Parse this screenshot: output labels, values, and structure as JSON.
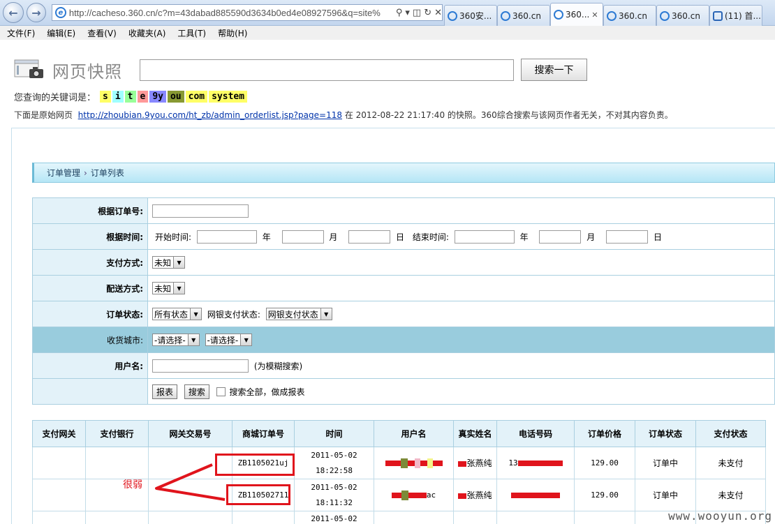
{
  "browser": {
    "address": "http://cacheso.360.cn/c?m=43dabad885590d3634b0ed4e08927596&q=site%",
    "tabs": [
      {
        "label": "360安..."
      },
      {
        "label": "360.cn"
      },
      {
        "label": "360..."
      },
      {
        "label": "360.cn"
      },
      {
        "label": "360.cn"
      },
      {
        "label": "(11) 首..."
      }
    ],
    "menu": [
      "文件(F)",
      "编辑(E)",
      "查看(V)",
      "收藏夹(A)",
      "工具(T)",
      "帮助(H)"
    ]
  },
  "snapshot": {
    "title": "网页快照",
    "search_button": "搜索一下",
    "keyword_label": "您查询的关键词是：",
    "keywords": [
      {
        "text": "s",
        "color": "#ffff66"
      },
      {
        "text": "i",
        "color": "#a0ffff"
      },
      {
        "text": "t",
        "color": "#99ff99"
      },
      {
        "text": "e",
        "color": "#ff9999"
      },
      {
        "text": "9y",
        "color": "#8888ff"
      },
      {
        "text": "ou",
        "color": "#889933"
      },
      {
        "text": "com",
        "color": "#ffff66"
      },
      {
        "text": "system",
        "color": "#ffff66"
      }
    ],
    "orig_prefix": "下面是原始网页",
    "orig_url": "http://zhoubian.9you.com/ht_zb/admin_orderlist.jsp?page=118",
    "orig_suffix": "在 2012-08-22 21:17:40 的快照。360综合搜索与该网页作者无关，不对其内容负责。"
  },
  "page": {
    "breadcrumb": [
      "订单管理",
      "订单列表"
    ],
    "filters": {
      "order_no_label": "根据订单号:",
      "time_label": "根据时间:",
      "start_label": "开始时间:",
      "end_label": "结束时间:",
      "year": "年",
      "month": "月",
      "day": "日",
      "pay_method_label": "支付方式:",
      "pay_method_value": "未知",
      "delivery_label": "配送方式:",
      "delivery_value": "未知",
      "status_label": "订单状态:",
      "status_value": "所有状态",
      "bank_status_label": "网银支付状态:",
      "bank_status_value": "网银支付状态",
      "city_label": "收货城市:",
      "city_value1": "-请选择-",
      "city_value2": "-请选择-",
      "user_label": "用户名:",
      "fuzzy_hint": "(为模糊搜索)",
      "report_button": "报表",
      "search_button": "搜索",
      "search_all_label": "搜索全部，做成报表"
    },
    "table": {
      "headers": [
        "支付网关",
        "支付银行",
        "网关交易号",
        "商城订单号",
        "时间",
        "用户名",
        "真实姓名",
        "电话号码",
        "订单价格",
        "订单状态",
        "支付状态"
      ],
      "rows": [
        {
          "order_no": "ZB1105021uj",
          "date": "2011-05-02",
          "time": "18:22:58",
          "real_name": "张燕纯",
          "phone_prefix": "13",
          "price": "129.00",
          "status": "订单中",
          "pay_status": "未支付"
        },
        {
          "order_no": "ZB110502711",
          "date": "2011-05-02",
          "time": "18:11:32",
          "user_suffix": "ac",
          "real_name": "张燕纯",
          "price": "129.00",
          "status": "订单中",
          "pay_status": "未支付"
        },
        {
          "date": "2011-05-02"
        }
      ]
    }
  },
  "annotation": {
    "note": "很弱"
  },
  "watermark": "www.wooyun.org",
  "colors": {
    "redact": "#e0141c",
    "header_bg": "#e3f2f9",
    "highlight_row": "#99ccdd"
  }
}
